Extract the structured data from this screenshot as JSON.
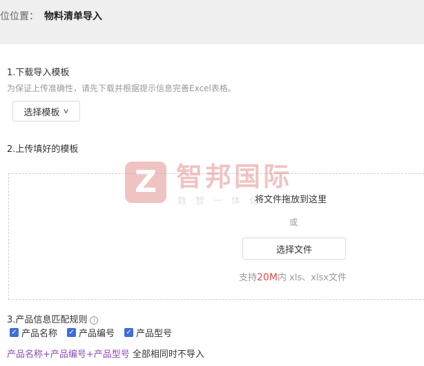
{
  "breadcrumb": {
    "prefix": "位位置：",
    "current": "物料清单导入"
  },
  "step1": {
    "title": "1.下载导入模板",
    "hint": "为保证上传准确性，请先下载并根据提示信息完善Excel表格。",
    "template_button": "选择模板"
  },
  "step2": {
    "title": "2.上传填好的模板",
    "drop_text": "将文件拖放到这里",
    "or_text": "或",
    "file_button": "选择文件",
    "support_prefix": "支持",
    "support_size": "20M",
    "support_suffix": "内 xls、xlsx文件"
  },
  "step3": {
    "title": "3.产品信息匹配规则",
    "options": [
      {
        "label": "产品名称",
        "checked": true
      },
      {
        "label": "产品编号",
        "checked": true
      },
      {
        "label": "产品型号",
        "checked": true
      }
    ],
    "rule_combo": "产品名称+产品编号+产品型号",
    "rule_text": " 全部相同时不导入"
  },
  "watermark": {
    "logo_letter": "Z",
    "name": "智邦国际",
    "sub": "数智一体化"
  },
  "colors": {
    "accent": "#3e6fd8",
    "highlight": "#e04848",
    "rule_combo": "#8a4bb8"
  }
}
